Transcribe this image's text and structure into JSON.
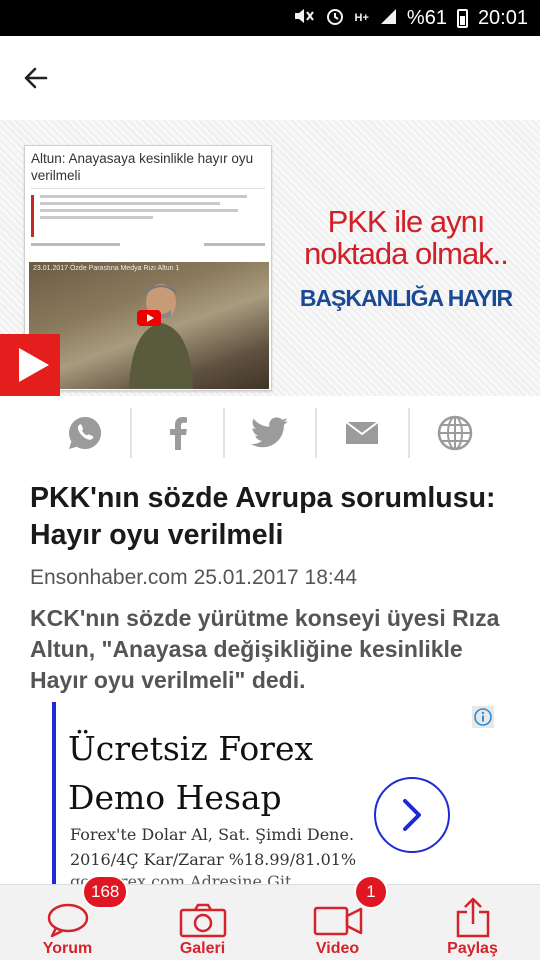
{
  "status_bar": {
    "battery": "%61",
    "time": "20:01",
    "icons": [
      "mute-icon",
      "alarm-icon",
      "data-icon",
      "signal-icon",
      "battery-icon"
    ]
  },
  "app_bar": {
    "back_icon": "arrow-left-icon"
  },
  "hero": {
    "card_title": "Altun: Anayasaya kesinlikle hayır oyu verilmeli",
    "video_caption": "23.01.2017 Özde Parastına Medya Rızı Altun 1",
    "line1": "PKK ile aynı",
    "line2": "noktada olmak..",
    "line3": "BAŞKANLIĞA HAYIR",
    "play_icon": "play-icon"
  },
  "share": {
    "items": [
      "whatsapp-icon",
      "facebook-icon",
      "twitter-icon",
      "mail-icon",
      "globe-icon"
    ]
  },
  "article": {
    "title": "PKK'nın sözde Avrupa sorumlusu: Hayır oyu verilmeli",
    "source": "Ensonhaber.com",
    "date": "25.01.2017 18:44",
    "summary": "KCK'nın sözde yürütme konseyi üyesi Rıza Altun, \"Anayasa değişikliğine kesinlikle Hayır oyu verilmeli\" dedi."
  },
  "ad": {
    "title": "Ücretsiz Forex Demo Hesap",
    "description": "Forex'te Dolar Al, Sat. Şimdi Dene. 2016/4Ç Kar/Zarar %18.99/81.01%",
    "url": "gcmforex.com Adresine Git",
    "accent": "#1e2bd3"
  },
  "bottom_bar": {
    "items": [
      {
        "label": "Yorum",
        "badge": "168",
        "icon": "comment-icon"
      },
      {
        "label": "Galeri",
        "badge": "",
        "icon": "camera-icon"
      },
      {
        "label": "Video",
        "badge": "1",
        "icon": "video-icon"
      },
      {
        "label": "Paylaş",
        "badge": "",
        "icon": "share-icon"
      }
    ],
    "accent": "#d5232b"
  }
}
